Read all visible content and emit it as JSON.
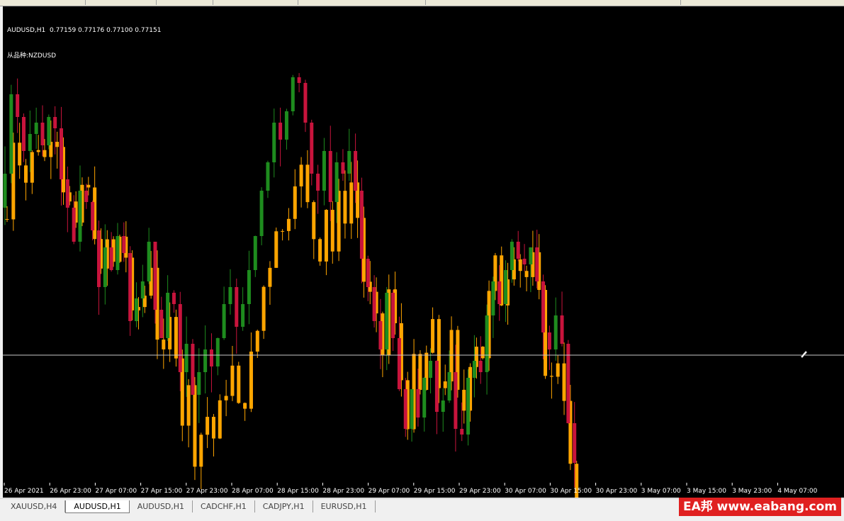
{
  "chart": {
    "symbol_line": "AUDUSD,H1  0.77159 0.77176 0.77100 0.77151",
    "sub_symbol_line": "从品种:NZDUSD",
    "price_max": 0.7775,
    "price_min": 0.7695,
    "horizontal_line_price": 0.7716,
    "bull_color": "#1e8c1e",
    "bear_color": "#c8143c",
    "second_color": "#ffa500",
    "hline_color": "#c8c8c8"
  },
  "time_axis_labels": [
    "26 Apr 2021",
    "26 Apr 23:00",
    "27 Apr 07:00",
    "27 Apr 15:00",
    "27 Apr 23:00",
    "28 Apr 07:00",
    "28 Apr 15:00",
    "28 Apr 23:00",
    "29 Apr 07:00",
    "29 Apr 15:00",
    "29 Apr 23:00",
    "30 Apr 07:00",
    "30 Apr 15:00",
    "30 Apr 23:00",
    "3 May 07:00",
    "3 May 15:00",
    "3 May 23:00",
    "4 May 07:00"
  ],
  "tabs": [
    {
      "label": "XAUUSD,H4",
      "active": false
    },
    {
      "label": "AUDUSD,H1",
      "active": true
    },
    {
      "label": "AUDUSD,H1",
      "active": false
    },
    {
      "label": "CADCHF,H1",
      "active": false
    },
    {
      "label": "CADJPY,H1",
      "active": false
    },
    {
      "label": "EURUSD,H1",
      "active": false
    }
  ],
  "watermark": "EA邦 www.eabang.com",
  "chart_data": {
    "type": "candlestick",
    "series_main_close": [
      0.7748,
      0.7762,
      0.7758,
      0.7752,
      0.7755,
      0.7757,
      0.7753,
      0.7758,
      0.7756,
      0.7747,
      0.7742,
      0.7736,
      0.7745,
      0.7743,
      0.7738,
      0.7728,
      0.7735,
      0.7731,
      0.7737,
      0.7734,
      0.7722,
      0.7726,
      0.7729,
      0.7736,
      0.7724,
      0.7719,
      0.7727,
      0.7725,
      0.7713,
      0.7718,
      0.7709,
      0.7713,
      0.7717,
      0.7714,
      0.7719,
      0.7725,
      0.7728,
      0.7721,
      0.7725,
      0.7731,
      0.7737,
      0.7745,
      0.775,
      0.7757,
      0.7754,
      0.7759,
      0.7765,
      0.7764,
      0.7757,
      0.7748,
      0.7745,
      0.7752,
      0.7743,
      0.775,
      0.7748,
      0.7752,
      0.7745,
      0.7733,
      0.7728,
      0.7722,
      0.7717,
      0.7727,
      0.7719,
      0.771,
      0.7703,
      0.771,
      0.7705,
      0.7712,
      0.7715,
      0.7706,
      0.7708,
      0.7713,
      0.7703,
      0.7702,
      0.7712,
      0.7715,
      0.7713,
      0.7723,
      0.7729,
      0.7725,
      0.7731,
      0.7736,
      0.7733,
      0.7732,
      0.7735,
      0.7729,
      0.772,
      0.7717,
      0.7723,
      0.7718,
      0.7704,
      0.7697
    ]
  }
}
